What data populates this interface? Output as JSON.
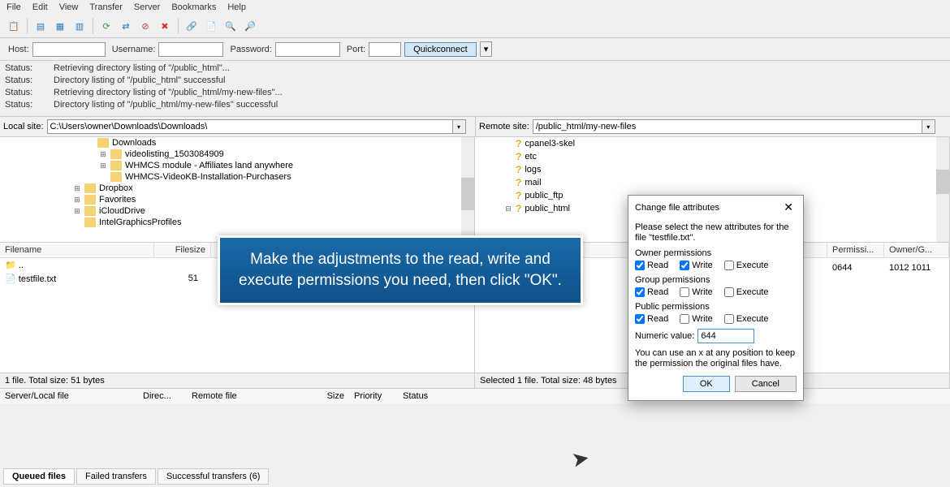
{
  "menu": [
    "File",
    "Edit",
    "View",
    "Transfer",
    "Server",
    "Bookmarks",
    "Help"
  ],
  "conn": {
    "host_lbl": "Host:",
    "user_lbl": "Username:",
    "pass_lbl": "Password:",
    "port_lbl": "Port:",
    "quick": "Quickconnect"
  },
  "status": [
    "Retrieving directory listing of \"/public_html\"...",
    "Directory listing of \"/public_html\" successful",
    "Retrieving directory listing of \"/public_html/my-new-files\"...",
    "Directory listing of \"/public_html/my-new-files\" successful"
  ],
  "status_lbl": "Status:",
  "local_lbl": "Local site:",
  "remote_lbl": "Remote site:",
  "local_path": "C:\\Users\\owner\\Downloads\\Downloads\\",
  "remote_path": "/public_html/my-new-files",
  "local_tree": [
    {
      "name": "Downloads",
      "indent": 0,
      "exp": ""
    },
    {
      "name": "videolisting_1503084909",
      "indent": 1,
      "exp": "⊞"
    },
    {
      "name": "WHMCS module - Affiliates land anywhere",
      "indent": 1,
      "exp": "⊞"
    },
    {
      "name": "WHMCS-VideoKB-Installation-Purchasers",
      "indent": 1,
      "exp": ""
    },
    {
      "name": "Dropbox",
      "indent": -1,
      "exp": "⊞"
    },
    {
      "name": "Favorites",
      "indent": -1,
      "exp": "⊞"
    },
    {
      "name": "iCloudDrive",
      "indent": -1,
      "exp": "⊞"
    },
    {
      "name": "IntelGraphicsProfiles",
      "indent": -1,
      "exp": ""
    }
  ],
  "remote_tree": [
    {
      "name": "cpanel3-skel"
    },
    {
      "name": "etc"
    },
    {
      "name": "logs"
    },
    {
      "name": "mail"
    },
    {
      "name": "public_ftp"
    },
    {
      "name": "public_html"
    }
  ],
  "list_cols": {
    "fn": "Filename",
    "fs": "Filesize",
    "perm": "Permissi...",
    "own": "Owner/G..."
  },
  "local_rows": [
    {
      "name": "..",
      "size": ""
    },
    {
      "name": "testfile.txt",
      "size": "51"
    }
  ],
  "remote_row": {
    "perm": "0644",
    "own": "1012 1011"
  },
  "status2": {
    "left": "1 file. Total size: 51 bytes",
    "right": "Selected 1 file. Total size: 48 bytes"
  },
  "qcols": {
    "sl": "Server/Local file",
    "dir": "Direc...",
    "rf": "Remote file",
    "sz": "Size",
    "pr": "Priority",
    "st": "Status"
  },
  "tabs": {
    "q": "Queued files",
    "f": "Failed transfers",
    "s": "Successful transfers (6)"
  },
  "tutorial": "Make the adjustments to the read, write and execute permissions you need, then click \"OK\".",
  "dialog": {
    "title": "Change file attributes",
    "desc": "Please select the new attributes for the file \"testfile.txt\".",
    "owner": "Owner permissions",
    "group": "Group permissions",
    "public": "Public permissions",
    "read": "Read",
    "write": "Write",
    "exec": "Execute",
    "num_lbl": "Numeric value:",
    "num_val": "644",
    "hint": "You can use an x at any position to keep the permission the original files have.",
    "ok": "OK",
    "cancel": "Cancel"
  }
}
